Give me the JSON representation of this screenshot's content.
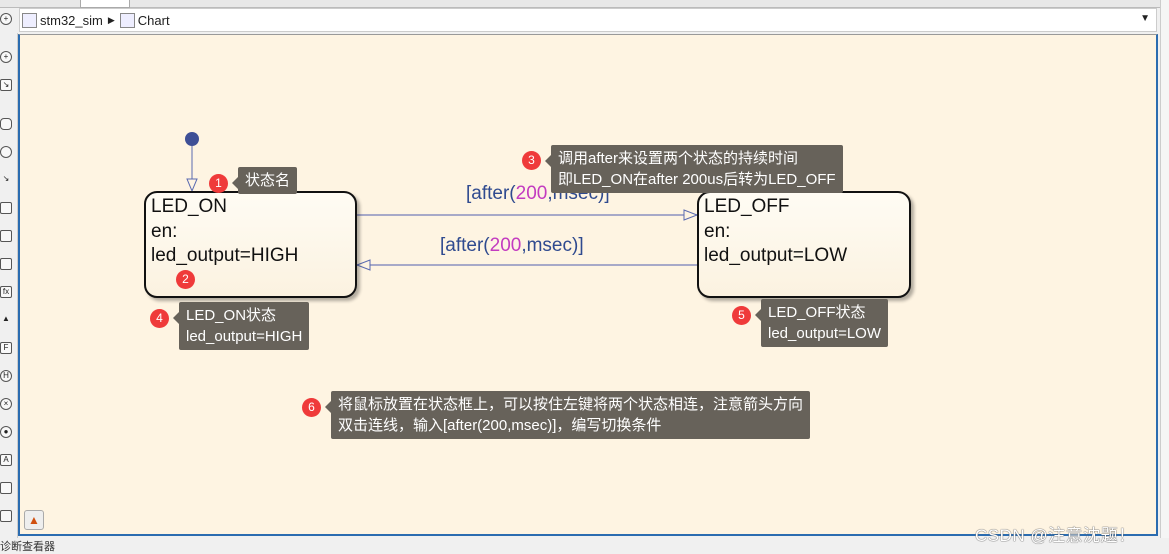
{
  "breadcrumb": {
    "items": [
      {
        "label": "stm32_sim",
        "icon": "simulink-model-icon"
      },
      {
        "label": "Chart",
        "icon": "stateflow-chart-icon"
      }
    ]
  },
  "chart": {
    "states": [
      {
        "name": "LED_ON",
        "action_label": "en:",
        "action": "led_output=HIGH"
      },
      {
        "name": "LED_OFF",
        "action_label": "en:",
        "action": "led_output=LOW"
      }
    ],
    "transitions": [
      {
        "pre": "[after(",
        "num": "200",
        "post": ",msec)]"
      },
      {
        "pre": "[after(",
        "num": "200",
        "post": ",msec)]"
      }
    ]
  },
  "annotations": [
    {
      "n": "1",
      "lines": [
        "状态名"
      ]
    },
    {
      "n": "2"
    },
    {
      "n": "3",
      "lines": [
        "调用after来设置两个状态的持续时间",
        "即LED_ON在after 200us后转为LED_OFF"
      ]
    },
    {
      "n": "4",
      "lines": [
        "LED_ON状态",
        "led_output=HIGH"
      ]
    },
    {
      "n": "5",
      "lines": [
        "LED_OFF状态",
        "led_output=LOW"
      ]
    },
    {
      "n": "6",
      "lines": [
        "将鼠标放置在状态框上，可以按住左键将两个状态相连，注意箭头方向",
        "双击连线，输入[after(200,msec)]，编写切换条件"
      ]
    }
  ],
  "bottom_panel": {
    "title": "诊断查看器"
  },
  "watermark": "CSDN @注意沈题！",
  "colors": {
    "canvas": "#fef4e2",
    "transition": "#2f4a8f",
    "number": "#c33bc0",
    "badge": "#ef3a3a",
    "note": "#67625a",
    "border": "#2b6cb0"
  }
}
